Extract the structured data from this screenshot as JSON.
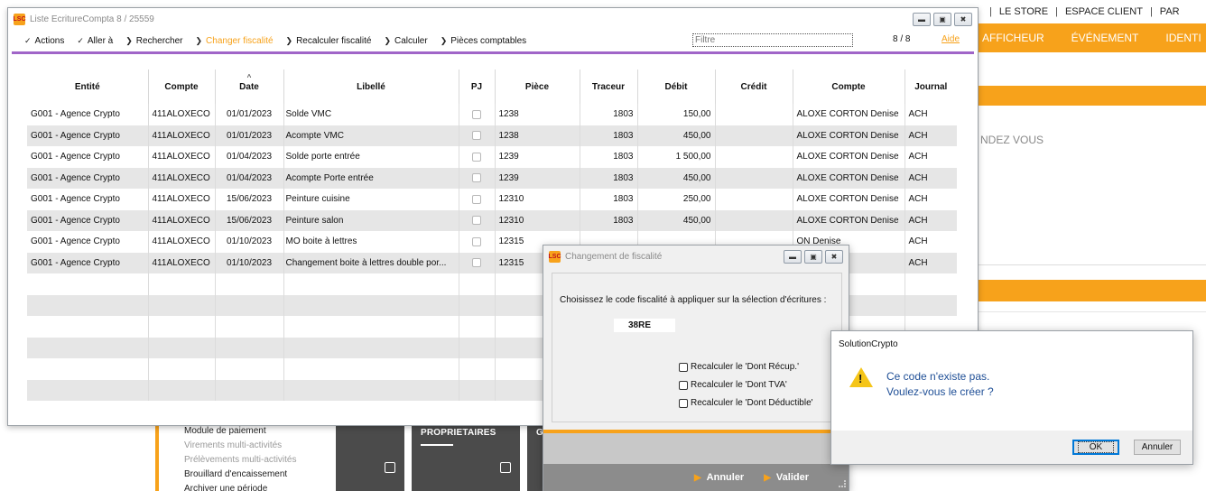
{
  "background": {
    "topnav": [
      "|",
      "LE STORE",
      "|",
      "ESPACE CLIENT",
      "|",
      "PAR"
    ],
    "orange_nav": [
      "AFFICHEUR",
      "ÉVÉNEMENT",
      "IDENTI"
    ],
    "rdv_text": "NDEZ VOUS",
    "left_menu": [
      "Module de paiement",
      "Virements multi-activités",
      "Prélèvements multi-activités",
      "Brouillard d'encaissement",
      "Archiver une période"
    ],
    "tile_title": "PROPRIETAIRES",
    "tile2_title": "GI"
  },
  "main_window": {
    "title": "Liste  EcritureCompta 8 / 25559",
    "logo": "LSC",
    "toolbar": {
      "actions": "Actions",
      "aller": "Aller à",
      "rechercher": "Rechercher",
      "changer": "Changer fiscalité",
      "recalculer": "Recalculer fiscalité",
      "calculer": "Calculer",
      "pieces": "Pièces comptables",
      "filter_placeholder": "Filtre",
      "count": "8 / 8",
      "help": "Aide"
    },
    "columns": [
      "Entité",
      "Compte",
      "Date",
      "Libellé",
      "PJ",
      "Pièce",
      "Traceur",
      "Débit",
      "Crédit",
      "Compte",
      "Journal"
    ],
    "rows": [
      [
        "G001 - Agence Crypto",
        "411ALOXECO",
        "01/01/2023",
        "Solde VMC",
        "",
        "1238",
        "1803",
        "150,00",
        "",
        "ALOXE CORTON Denise",
        "ACH"
      ],
      [
        "G001 - Agence Crypto",
        "411ALOXECO",
        "01/01/2023",
        "Acompte VMC",
        "",
        "1238",
        "1803",
        "450,00",
        "",
        "ALOXE CORTON Denise",
        "ACH"
      ],
      [
        "G001 - Agence Crypto",
        "411ALOXECO",
        "01/04/2023",
        "Solde porte entrée",
        "",
        "1239",
        "1803",
        "1 500,00",
        "",
        "ALOXE CORTON Denise",
        "ACH"
      ],
      [
        "G001 - Agence Crypto",
        "411ALOXECO",
        "01/04/2023",
        "Acompte Porte entrée",
        "",
        "1239",
        "1803",
        "450,00",
        "",
        "ALOXE CORTON Denise",
        "ACH"
      ],
      [
        "G001 - Agence Crypto",
        "411ALOXECO",
        "15/06/2023",
        "Peinture cuisine",
        "",
        "12310",
        "1803",
        "250,00",
        "",
        "ALOXE CORTON Denise",
        "ACH"
      ],
      [
        "G001 - Agence Crypto",
        "411ALOXECO",
        "15/06/2023",
        "Peinture salon",
        "",
        "12310",
        "1803",
        "450,00",
        "",
        "ALOXE CORTON Denise",
        "ACH"
      ],
      [
        "G001 - Agence Crypto",
        "411ALOXECO",
        "01/10/2023",
        "MO boite à lettres",
        "",
        "12315",
        "",
        "",
        "",
        "ON Denise",
        "ACH"
      ],
      [
        "G001 - Agence Crypto",
        "411ALOXECO",
        "01/10/2023",
        "Changement boite à lettres double por...",
        "",
        "12315",
        "",
        "",
        "",
        "ON Denise",
        "ACH"
      ]
    ]
  },
  "fisc_dialog": {
    "title": "Changement de fiscalité",
    "question": "Choisissez le code fiscalité à appliquer sur la sélection d'écritures :",
    "code_value": "38RE",
    "options": [
      "Recalculer le 'Dont Récup.'",
      "Recalculer le 'Dont TVA'",
      "Recalculer le 'Dont Déductible'"
    ],
    "cancel": "Annuler",
    "validate": "Valider"
  },
  "msg_box": {
    "title": "SolutionCrypto",
    "line1": "Ce code n'existe pas.",
    "line2": "Voulez-vous le créer ?",
    "ok": "OK",
    "cancel": "Annuler"
  }
}
